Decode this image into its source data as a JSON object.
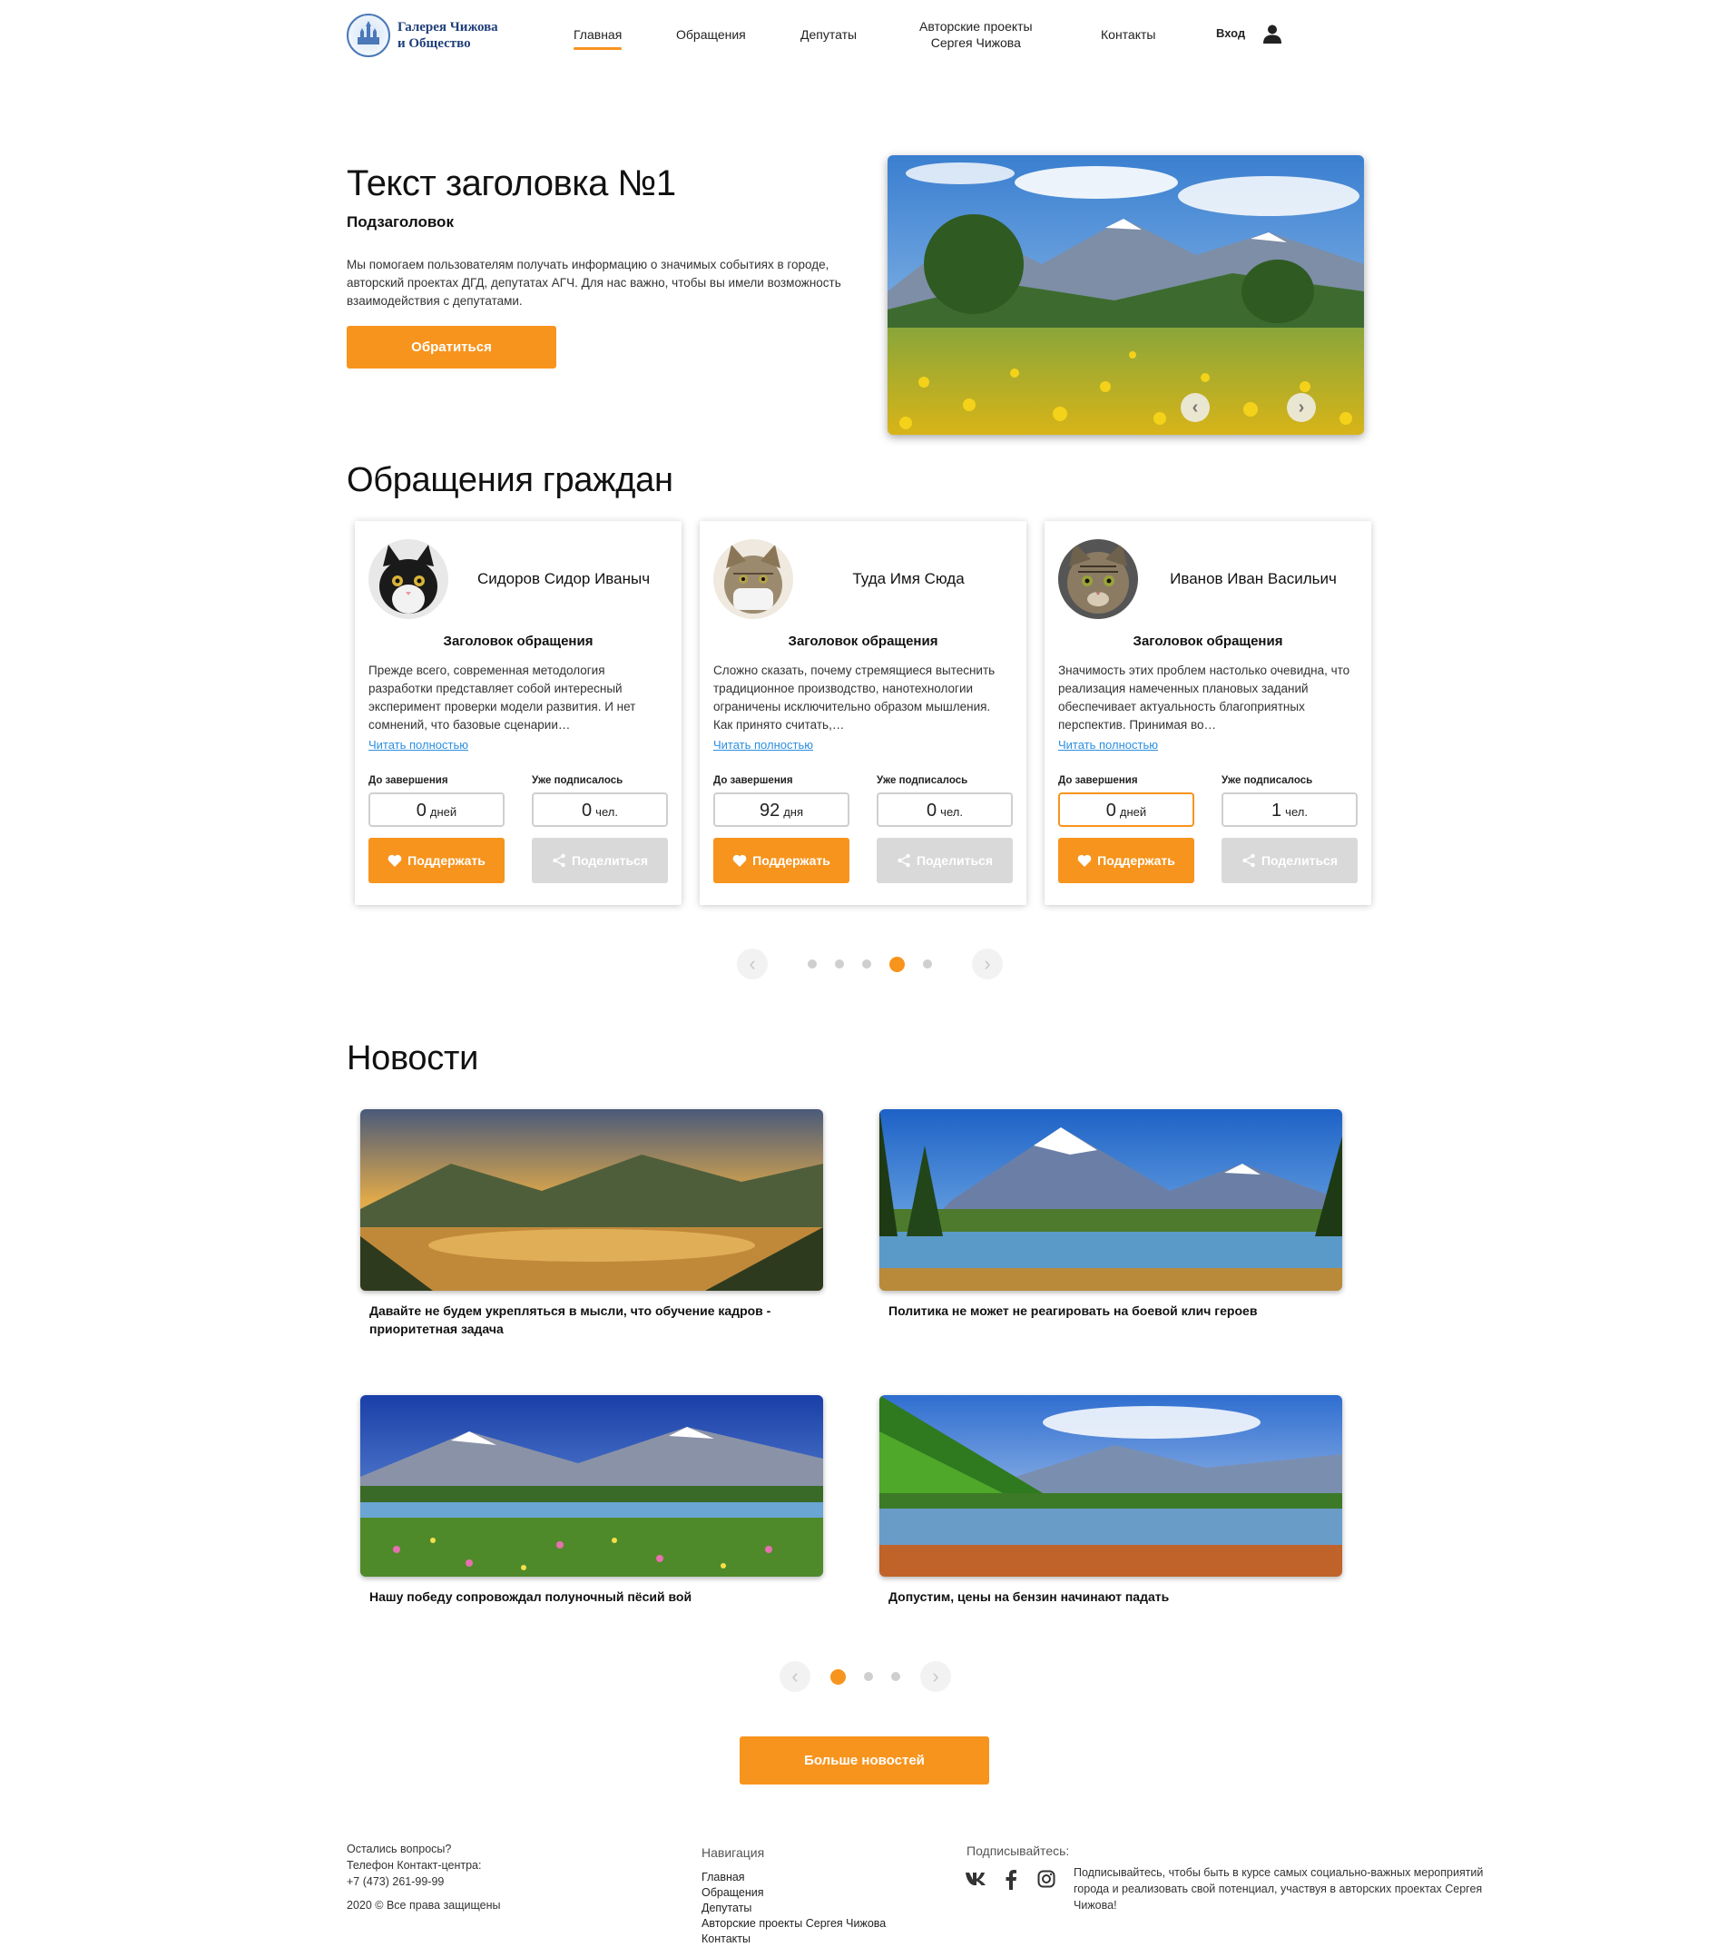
{
  "header": {
    "logo_line1": "Галерея Чижова",
    "logo_line2": "и Общество",
    "nav": [
      "Главная",
      "Обращения",
      "Депутаты",
      "Авторские проекты",
      "Сергея Чижова",
      "Контакты"
    ],
    "login": "Вход",
    "accent": "#f7941d"
  },
  "hero": {
    "title": "Текст заголовка №1",
    "subtitle": "Подзаголовок",
    "text": "Мы помогаем пользователям получать информацию о значимых событиях в городе, авторский проектах ДГД, депутатах АГЧ. Для нас важно, чтобы вы имели возможность взаимодействия с депутатами.",
    "button": "Обратиться",
    "arrow_prev": "‹",
    "arrow_next": "›"
  },
  "appeals": {
    "title": "Обращения граждан",
    "label_left": "До завершения",
    "label_right": "Уже подписалось",
    "read_more": "Читать полностью",
    "support": "Поддержать",
    "share": "Поделиться",
    "cards": [
      {
        "name": "Сидоров Сидор Иваныч",
        "title": "Заголовок обращения",
        "text": "Прежде всего, современная методология разработки представляет собой интересный эксперимент проверки модели развития. И нет сомнений, что базовые сценарии…",
        "days": "0",
        "days_unit": "дней",
        "signed": "0",
        "signed_unit": "чел."
      },
      {
        "name": "Туда Имя Сюда",
        "title": "Заголовок обращения",
        "text": "Сложно сказать, почему стремящиеся вытеснить традиционное производство, нанотехнологии ограничены исключительно образом мышления. Как принято считать,…",
        "days": "92",
        "days_unit": "дня",
        "signed": "0",
        "signed_unit": "чел."
      },
      {
        "name": "Иванов Иван Васильич",
        "title": "Заголовок обращения",
        "text": "Значимость этих проблем настолько очевидна, что реализация намеченных плановых заданий обеспечивает актуальность благоприятных перспектив. Принимая во…",
        "days": "0",
        "days_unit": "дней",
        "signed": "1",
        "signed_unit": "чел."
      }
    ]
  },
  "news": {
    "title": "Новости",
    "items": [
      "Давайте не будем укрепляться в мысли, что обучение кадров - приоритетная задача",
      "Политика не может не реагировать на боевой клич героев",
      "Нашу победу сопровождал полуночный пёсий вой",
      "Допустим, цены на бензин начинают падать"
    ],
    "more_button": "Больше новостей"
  },
  "footer": {
    "questions": "Остались вопросы?",
    "phone_label": "Телефон Контакт-центра:",
    "phone": "+7 (473) 261-99-99",
    "copyright": "2020 © Все права защищены",
    "nav_title": "Навигация",
    "nav": [
      "Главная",
      "Обращения",
      "Депутаты",
      "Авторские проекты Сергея Чижова",
      "Контакты"
    ],
    "subscribe_title": "Подписывайтесь:",
    "subscribe_text": "Подписывайтесь, чтобы быть в курсе самых социально-важных мероприятий города и реализовать свой потенциал, участвуя в авторских проектах Сергея Чижова!",
    "social": [
      "vk-icon",
      "facebook-icon",
      "instagram-icon"
    ]
  }
}
